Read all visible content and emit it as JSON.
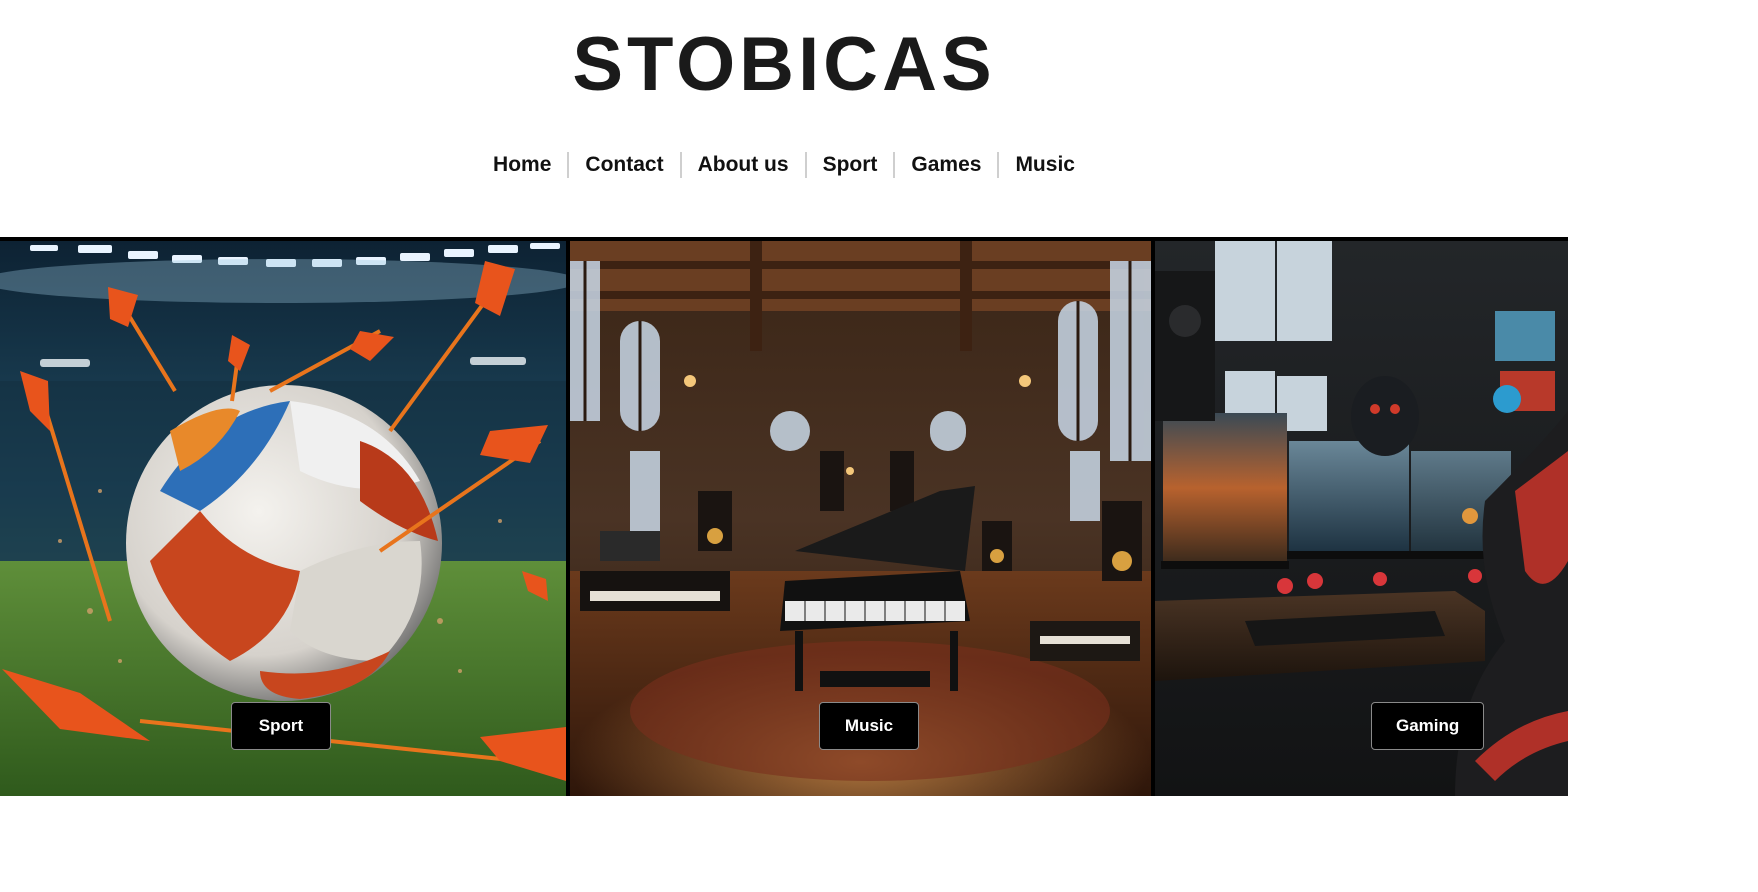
{
  "brand": {
    "logo_text": "STOBICAS"
  },
  "nav": {
    "items": [
      {
        "label": "Home"
      },
      {
        "label": "Contact"
      },
      {
        "label": "About us"
      },
      {
        "label": "Sport"
      },
      {
        "label": "Games"
      },
      {
        "label": "Music"
      }
    ]
  },
  "gallery": {
    "panels": [
      {
        "button_label": "Sport",
        "image": "soccer-ball-with-darts-in-stadium"
      },
      {
        "button_label": "Music",
        "image": "music-studio-with-grand-piano"
      },
      {
        "button_label": "Gaming",
        "image": "gaming-room-with-triple-monitors"
      }
    ]
  },
  "colors": {
    "text": "#111111",
    "separator": "#cfcfcf",
    "button_bg": "#000000",
    "button_text": "#ffffff",
    "accent_orange": "#e8541c"
  }
}
